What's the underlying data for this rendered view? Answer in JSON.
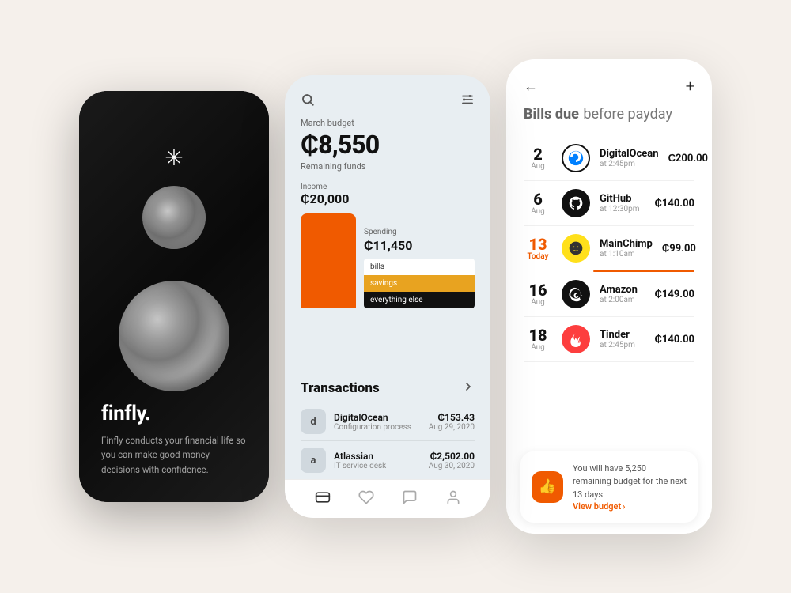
{
  "screen1": {
    "brand": "finfly.",
    "tagline": "Finfly conducts your financial life so you can make good money decisions with confidence.",
    "asterisk": "✳"
  },
  "screen2": {
    "header": {
      "period": "March budget",
      "search_icon": "search",
      "filter_icon": "filter"
    },
    "budget": {
      "currency": "₵",
      "amount": "8,550",
      "remaining_label": "Remaining funds",
      "income_label": "Income",
      "income_amount": "₵20,000",
      "spending_label": "Spending",
      "spending_amount": "₵11,450",
      "legend": [
        {
          "label": "bills",
          "color": "white"
        },
        {
          "label": "savings",
          "color": "amber"
        },
        {
          "label": "everything else",
          "color": "black"
        }
      ]
    },
    "transactions": {
      "title": "Transactions",
      "items": [
        {
          "icon": "d",
          "name": "DigitalOcean",
          "sub": "Configuration process",
          "amount": "₵153.43",
          "date": "Aug 29, 2020"
        },
        {
          "icon": "a",
          "name": "Atlassian",
          "sub": "IT service desk",
          "amount": "₵2,502.00",
          "date": "Aug 30, 2020"
        }
      ]
    },
    "nav_icons": [
      "💳",
      "♡",
      "💬",
      "👤"
    ]
  },
  "screen3": {
    "header": {
      "back_icon": "←",
      "plus_icon": "+"
    },
    "title_bold": "Bills due",
    "title_light": "before payday",
    "bills": [
      {
        "day": "2",
        "month": "Aug",
        "name": "DigitalOcean",
        "time": "at 2:45pm",
        "amount": "₵200.00",
        "icon_type": "digitalocean",
        "today": false
      },
      {
        "day": "6",
        "month": "Aug",
        "name": "GitHub",
        "time": "at 12:30pm",
        "amount": "₵140.00",
        "icon_type": "github",
        "today": false
      },
      {
        "day": "13",
        "month": "Today",
        "name": "MainChimp",
        "time": "at 1:10am",
        "amount": "₵99.00",
        "icon_type": "mailchimp",
        "today": true
      },
      {
        "day": "16",
        "month": "Aug",
        "name": "Amazon",
        "time": "at 2:00am",
        "amount": "₵149.00",
        "icon_type": "amazon",
        "today": false
      },
      {
        "day": "18",
        "month": "Aug",
        "name": "Tinder",
        "time": "at 2:45pm",
        "amount": "₵140.00",
        "icon_type": "tinder",
        "today": false
      }
    ],
    "footer": {
      "remaining": "5,250",
      "days": "13",
      "message": "You will have 5,250 remaining budget for the next 13 days.",
      "link": "View budget"
    }
  }
}
